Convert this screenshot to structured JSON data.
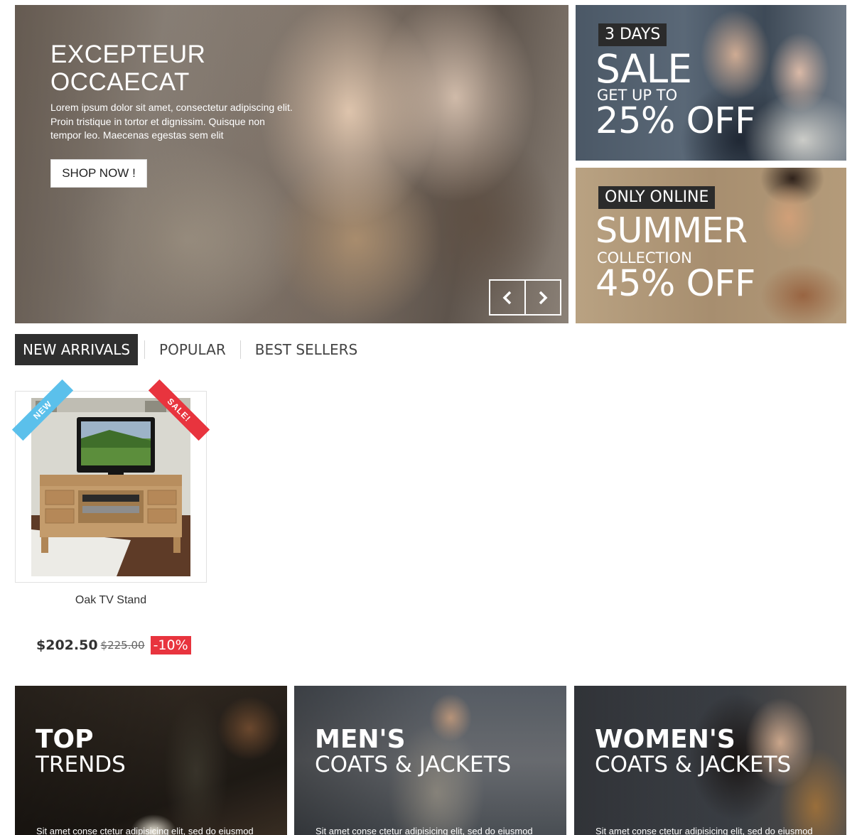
{
  "hero": {
    "title_line1": "EXCEPTEUR",
    "title_line2": "OCCAECAT",
    "text": "Lorem ipsum dolor sit amet, consectetur adipiscing elit. Proin tristique in tortor et dignissim. Quisque non tempor leo. Maecenas egestas sem elit",
    "button_label": "SHOP NOW !",
    "prev_icon": "chevron-left-icon",
    "next_icon": "chevron-right-icon"
  },
  "banners": [
    {
      "badge": "3 DAYS",
      "headline": "SALE",
      "subline": "GET UP TO",
      "offer": "25% OFF"
    },
    {
      "badge": "ONLY ONLINE",
      "headline": "SUMMER",
      "subline": "COLLECTION",
      "offer": "45% OFF"
    }
  ],
  "tabs": [
    {
      "label": "NEW ARRIVALS",
      "active": true
    },
    {
      "label": "POPULAR",
      "active": false
    },
    {
      "label": "BEST SELLERS",
      "active": false
    }
  ],
  "product": {
    "name": "Oak TV Stand",
    "ribbon_new": "NEW",
    "ribbon_sale": "SALE!",
    "price": "$202.50",
    "old_price": "$225.00",
    "discount": "-10%"
  },
  "categories": [
    {
      "title": "TOP",
      "subtitle": "TRENDS",
      "desc": "Sit amet conse ctetur adipisicing elit, sed do eiusmod"
    },
    {
      "title": "MEN'S",
      "subtitle": "COATS & JACKETS",
      "desc": "Sit amet conse ctetur adipisicing elit, sed do eiusmod"
    },
    {
      "title": "WOMEN'S",
      "subtitle": "COATS & JACKETS",
      "desc": "Sit amet conse ctetur adipisicing elit, sed do eiusmod"
    }
  ],
  "colors": {
    "accent_dark": "#2f2f2f",
    "sale_red": "#e8343e",
    "new_blue": "#5bc0eb"
  }
}
